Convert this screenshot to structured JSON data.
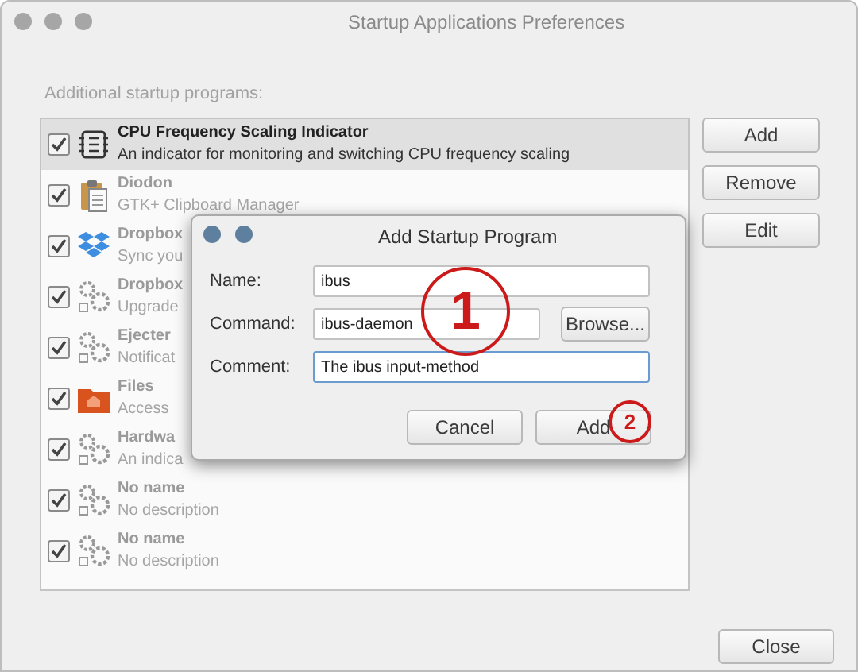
{
  "window": {
    "title": "Startup Applications Preferences"
  },
  "list_label": "Additional startup programs:",
  "programs": [
    {
      "kind": "chip",
      "name": "CPU Frequency Scaling Indicator",
      "description": "An indicator for monitoring and switching CPU frequency scaling",
      "checked": true,
      "selected": true
    },
    {
      "kind": "clipboard",
      "name": "Diodon",
      "description": "GTK+ Clipboard Manager",
      "checked": true,
      "selected": false
    },
    {
      "kind": "dropbox",
      "name": "Dropbox",
      "description": "Sync you",
      "checked": true,
      "selected": false
    },
    {
      "kind": "gears",
      "name": "Dropbox",
      "description": "Upgrade",
      "checked": true,
      "selected": false
    },
    {
      "kind": "gears",
      "name": "Ejecter",
      "description": "Notificat",
      "checked": true,
      "selected": false
    },
    {
      "kind": "folder",
      "name": "Files",
      "description": "Access",
      "checked": true,
      "selected": false
    },
    {
      "kind": "gears",
      "name": "Hardwa",
      "description": "An indica",
      "checked": true,
      "selected": false
    },
    {
      "kind": "gears",
      "name": "No name",
      "description": "No description",
      "checked": true,
      "selected": false
    },
    {
      "kind": "gears",
      "name": "No name",
      "description": "No description",
      "checked": true,
      "selected": false
    }
  ],
  "side_buttons": [
    "Add",
    "Remove",
    "Edit"
  ],
  "close_button": "Close",
  "dialog": {
    "title": "Add Startup Program",
    "fields": [
      {
        "label": "Name:",
        "value": "ibus",
        "focused": false
      },
      {
        "label": "Command:",
        "value": "ibus-daemon",
        "focused": false,
        "button": "Browse..."
      },
      {
        "label": "Comment:",
        "value": "The ibus input-method",
        "focused": true
      }
    ],
    "buttons": [
      "Cancel",
      "Add"
    ]
  },
  "annotations": [
    "1",
    "2"
  ]
}
